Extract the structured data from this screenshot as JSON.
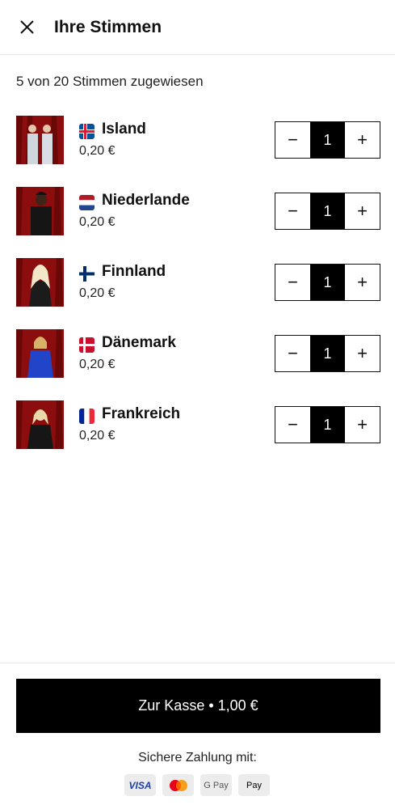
{
  "header": {
    "title": "Ihre Stimmen",
    "close_icon": "close-icon"
  },
  "summary": "5 von 20 Stimmen zugewiesen",
  "entries": [
    {
      "country": "Island",
      "price": "0,20 €",
      "votes": "1",
      "minus": "−",
      "plus": "+",
      "flag_icon": "flag-iceland-icon"
    },
    {
      "country": "Niederlande",
      "price": "0,20 €",
      "votes": "1",
      "minus": "−",
      "plus": "+",
      "flag_icon": "flag-netherlands-icon"
    },
    {
      "country": "Finnland",
      "price": "0,20 €",
      "votes": "1",
      "minus": "−",
      "plus": "+",
      "flag_icon": "flag-finland-icon"
    },
    {
      "country": "Dänemark",
      "price": "0,20 €",
      "votes": "1",
      "minus": "−",
      "plus": "+",
      "flag_icon": "flag-denmark-icon"
    },
    {
      "country": "Frankreich",
      "price": "0,20 €",
      "votes": "1",
      "minus": "−",
      "plus": "+",
      "flag_icon": "flag-france-icon"
    }
  ],
  "checkout_label": "Zur Kasse • 1,00 €",
  "secure_payment": "Sichere Zahlung mit:",
  "payment_methods": {
    "visa": "VISA",
    "mastercard": "mastercard-icon",
    "gpay": "G Pay",
    "applepay": " Pay"
  },
  "colors": {
    "primary": "#000000",
    "background": "#ffffff",
    "divider": "#e6e6e6",
    "curtain": "#8b0d0d"
  }
}
